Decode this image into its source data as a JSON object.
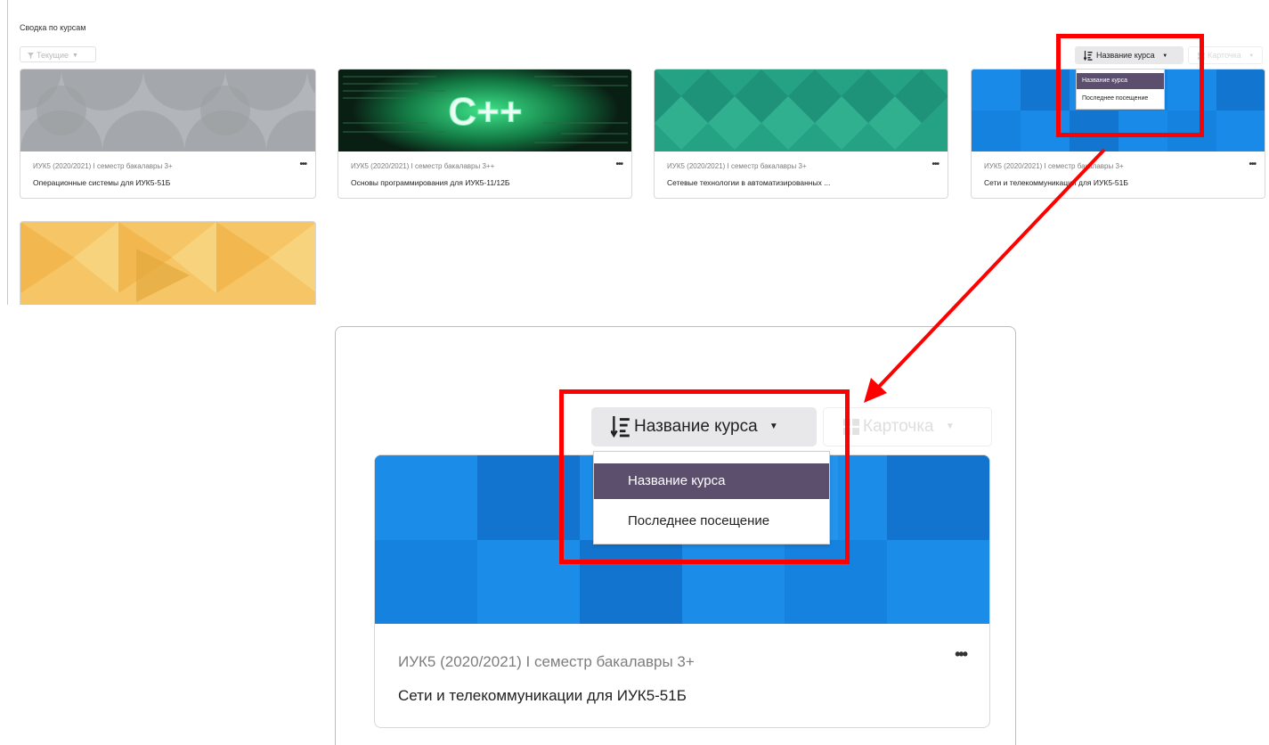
{
  "overview": {
    "title": "Сводка по курсам",
    "filter_label": "Текущие",
    "sort_label": "Название курса",
    "view_label": "Карточка",
    "sort_options": [
      "Название курса",
      "Последнее посещение"
    ]
  },
  "courses": [
    {
      "meta": "ИУК5 (2020/2021) I семестр бакалавры 3+",
      "name": "Операционные системы для ИУК5-51Б",
      "image": "gray-circles"
    },
    {
      "meta": "ИУК5 (2020/2021) I семестр бакалавры 3++",
      "name": "Основы программирования для ИУК5-11/12Б",
      "image": "cpp-code",
      "image_text": "C++"
    },
    {
      "meta": "ИУК5 (2020/2021) I семестр бакалавры 3+",
      "name": "Сетевые технологии в автоматизированных ...",
      "image": "green-diamonds"
    },
    {
      "meta": "ИУК5 (2020/2021) I семестр бакалавры 3+",
      "name": "Сети и телекоммуникации для ИУК5-51Б",
      "image": "blue-squares"
    },
    {
      "image": "yellow-triangles"
    }
  ],
  "zoom": {
    "sort_label": "Название курса",
    "view_label": "Карточка",
    "sort_options": [
      "Название курса",
      "Последнее посещение"
    ],
    "card": {
      "meta": "ИУК5 (2020/2021) I семестр бакалавры 3+",
      "name": "Сети и телекоммуникации для ИУК5-51Б"
    }
  },
  "colors": {
    "highlight": "#ff0000",
    "active_option": "#5b4f6d",
    "blue_card": "#1682e0"
  }
}
